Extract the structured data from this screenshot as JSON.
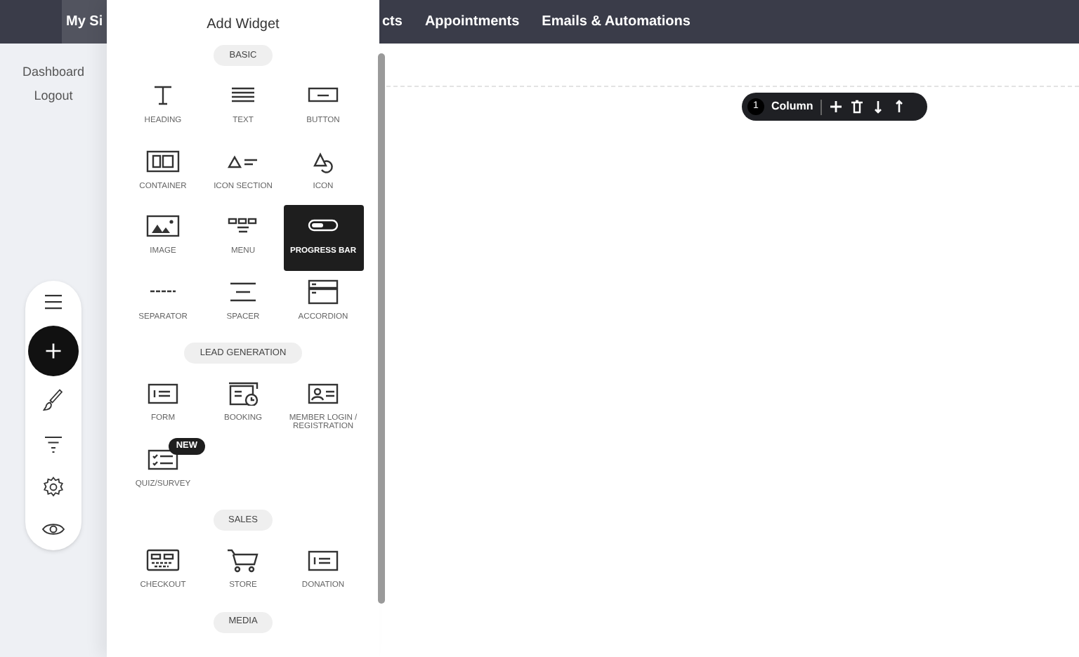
{
  "top_nav": [
    {
      "label": "My Si",
      "selected": true
    },
    {
      "label": "cts",
      "selected": false
    },
    {
      "label": "Appointments",
      "selected": false
    },
    {
      "label": "Emails & Automations",
      "selected": false
    }
  ],
  "sidebar": {
    "items": [
      "Dashboard",
      "Logout"
    ]
  },
  "tool_rail": [
    {
      "selected": false
    },
    {
      "selected": true
    },
    {
      "selected": false
    },
    {
      "selected": false
    },
    {
      "selected": false
    },
    {
      "selected": false
    }
  ],
  "panel": {
    "title": "Add Widget",
    "sections": [
      {
        "title": "BASIC",
        "items": [
          {
            "label": "HEADING",
            "selected": false
          },
          {
            "label": "TEXT",
            "selected": false
          },
          {
            "label": "BUTTON",
            "selected": false
          },
          {
            "label": "CONTAINER",
            "selected": false
          },
          {
            "label": "ICON SECTION",
            "selected": false
          },
          {
            "label": "ICON",
            "selected": false
          },
          {
            "label": "IMAGE",
            "selected": false
          },
          {
            "label": "MENU",
            "selected": false
          },
          {
            "label": "PROGRESS BAR",
            "selected": true
          },
          {
            "label": "SEPARATOR",
            "selected": false
          },
          {
            "label": "SPACER",
            "selected": false
          },
          {
            "label": "ACCORDION",
            "selected": false
          }
        ]
      },
      {
        "title": "LEAD GENERATION",
        "items": [
          {
            "label": "FORM",
            "selected": false
          },
          {
            "label": "BOOKING",
            "selected": false
          },
          {
            "label": "MEMBER LOGIN / REGISTRATION",
            "selected": false
          },
          {
            "label": "QUIZ/SURVEY",
            "selected": false,
            "badge": "NEW"
          }
        ]
      },
      {
        "title": "SALES",
        "items": [
          {
            "label": "CHECKOUT",
            "selected": false
          },
          {
            "label": "STORE",
            "selected": false
          },
          {
            "label": "DONATION",
            "selected": false
          }
        ]
      },
      {
        "title": "MEDIA"
      }
    ]
  },
  "column_toolbar": {
    "count": "1",
    "label": "Column"
  }
}
